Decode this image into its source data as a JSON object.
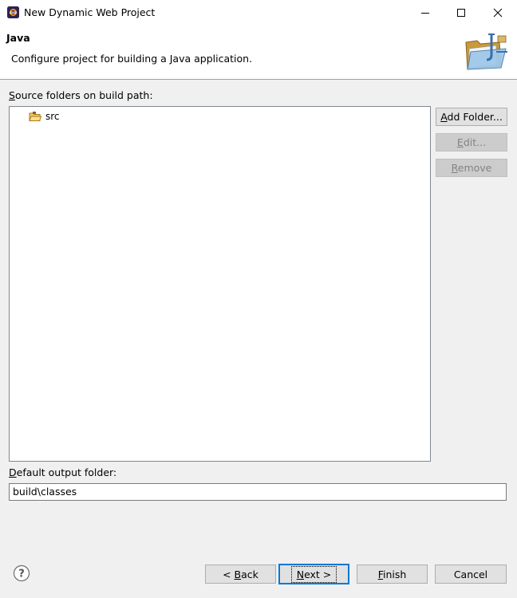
{
  "window": {
    "title": "New Dynamic Web Project",
    "controls": [
      "minimize",
      "maximize",
      "close"
    ]
  },
  "header": {
    "title": "Java",
    "description": "Configure project for building a Java application.",
    "icon": "java-folder-banner-icon"
  },
  "source_folders": {
    "label_mnemonic": "S",
    "label_rest": "ource folders on build path:",
    "items": [
      {
        "label": "src",
        "icon": "source-folder-icon"
      }
    ]
  },
  "side_buttons": {
    "add_folder": {
      "mnemonic": "A",
      "rest": "dd Folder...",
      "enabled": true
    },
    "edit": {
      "mnemonic": "E",
      "rest": "dit...",
      "enabled": false
    },
    "remove": {
      "mnemonic": "R",
      "rest": "emove",
      "enabled": false
    }
  },
  "output_folder": {
    "label_mnemonic": "D",
    "label_rest": "efault output folder:",
    "value": "build\\classes"
  },
  "footer": {
    "help_icon": "help-icon",
    "back": {
      "prefix": "< ",
      "mnemonic": "B",
      "rest": "ack"
    },
    "next": {
      "mnemonic": "N",
      "rest": "ext >"
    },
    "finish": {
      "mnemonic": "F",
      "rest": "inish"
    },
    "cancel": {
      "label": "Cancel"
    }
  },
  "colors": {
    "default_button_border": "#0078d7",
    "disabled_button_bg": "#cccccc",
    "dialog_bg": "#f0f0f0"
  }
}
